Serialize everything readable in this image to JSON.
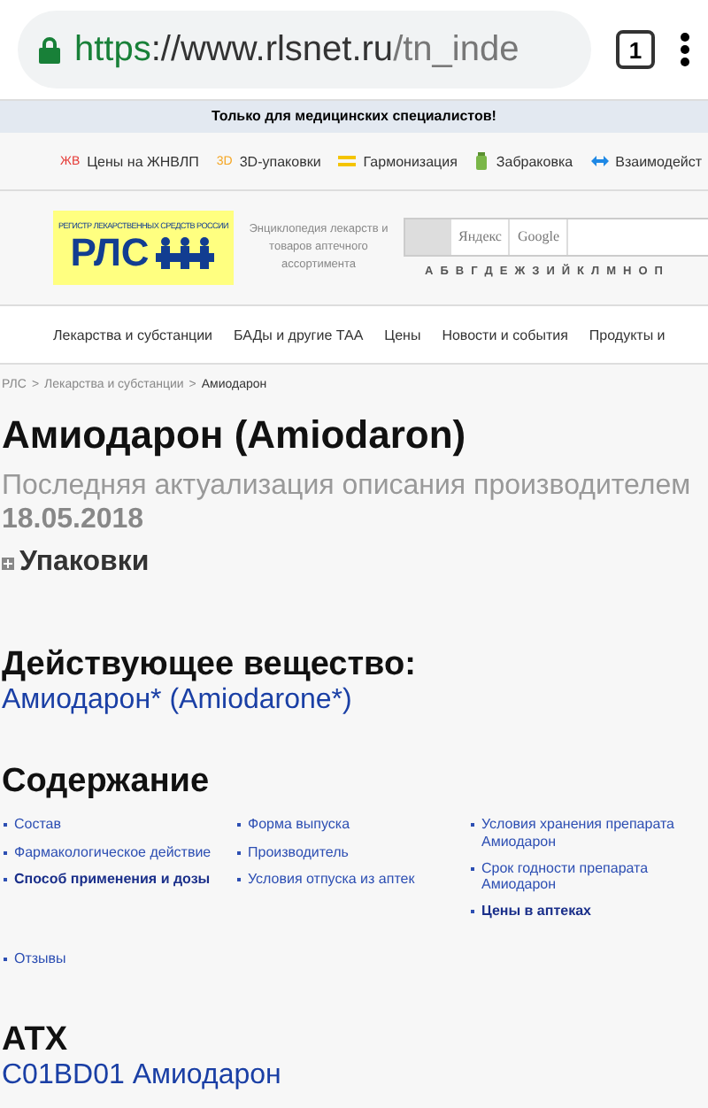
{
  "browser": {
    "url_scheme": "https",
    "url_host": "://www.rlsnet.ru",
    "url_path": "/tn_inde",
    "tab_count": "1"
  },
  "notice": "Только для медицинских специалистов!",
  "toolbar": [
    {
      "kind": "badge",
      "mark": "ЖВ",
      "label": "Цены на ЖНВЛП"
    },
    {
      "kind": "badge3d",
      "mark": "3D",
      "label": "3D-упаковки"
    },
    {
      "kind": "bars",
      "label": "Гармонизация"
    },
    {
      "kind": "bottle",
      "label": "Забраковка"
    },
    {
      "kind": "arrows",
      "label": "Взаимодейст"
    }
  ],
  "header": {
    "logo_top": "РЕГИСТР ЛЕКАРСТВЕННЫХ СРЕДСТВ РОССИИ",
    "logo_main": "РЛС",
    "tagline": "Энциклопедия лекарств и товаров аптечного ассортимента",
    "search_tabs": [
      "Яндекс",
      "Google"
    ],
    "alphabet": [
      "А",
      "Б",
      "В",
      "Г",
      "Д",
      "Е",
      "Ж",
      "З",
      "И",
      "Й",
      "К",
      "Л",
      "М",
      "Н",
      "О",
      "П"
    ]
  },
  "nav": [
    "Лекарства и субстанции",
    "БАДы и другие ТАА",
    "Цены",
    "Новости и события",
    "Продукты и"
  ],
  "breadcrumb": {
    "separator": ">",
    "items": [
      "РЛС",
      "Лекарства и субстанции",
      "Амиодарон"
    ]
  },
  "title": "Амиодарон (Amiodaron)",
  "updated": "Последняя актуализация описания производителем **18.05.2018**",
  "packages": {
    "label": "Упаковки",
    "expanded": false
  },
  "substance": {
    "heading": "Действующее вещество:",
    "link": "Амиодарон* (Amiodarone*)"
  },
  "contents": {
    "heading": "Содержание",
    "columns": [
      [
        {
          "label": "Состав",
          "emphasized": false
        },
        {
          "label": "Фармакологическое действие",
          "emphasized": false
        },
        {
          "label": "Способ применения и дозы",
          "emphasized": true
        }
      ],
      [
        {
          "label": "Форма выпуска",
          "emphasized": false
        },
        {
          "label": "Производитель",
          "emphasized": false
        },
        {
          "label": "Условия отпуска из аптек",
          "emphasized": false
        }
      ],
      [
        {
          "label": "Условия хранения препарата Амиодарон",
          "emphasized": false
        },
        {
          "label": "Срок годности препарата Амиодарон",
          "emphasized": false
        },
        {
          "label": "Цены в аптеках",
          "emphasized": true
        }
      ]
    ],
    "extra": [
      {
        "label": "Отзывы",
        "emphasized": false
      }
    ]
  },
  "atc": {
    "heading": "АТХ",
    "link": "C01BD01 Амиодарон"
  }
}
